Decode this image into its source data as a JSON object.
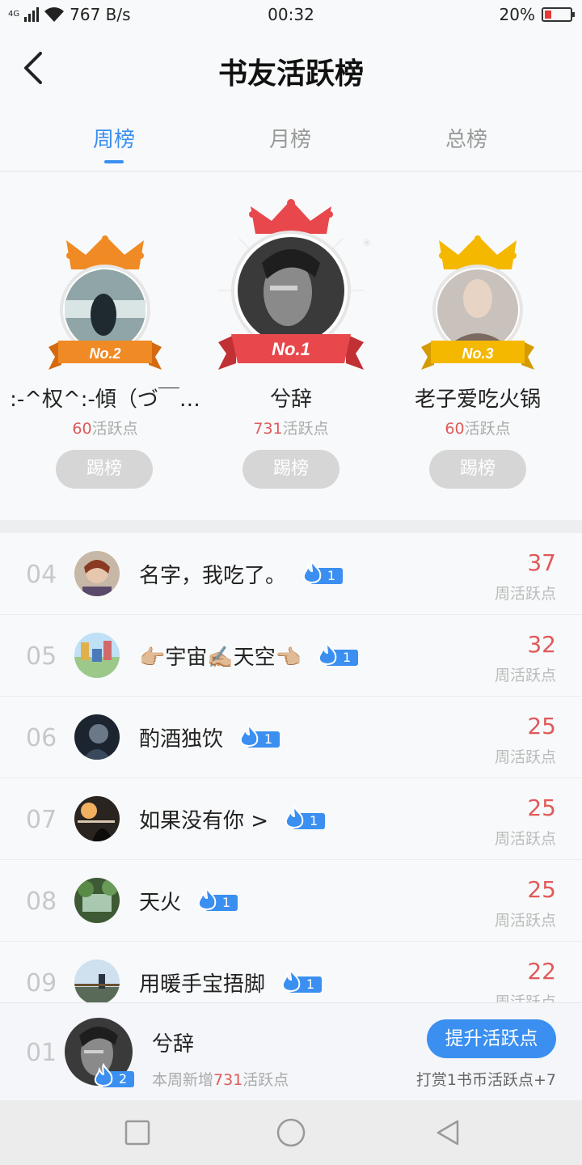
{
  "status_bar": {
    "network": "4G",
    "speed": "767 B/s",
    "time": "00:32",
    "battery": "20%"
  },
  "header": {
    "title": "书友活跃榜"
  },
  "tabs": [
    {
      "label": "周榜",
      "active": true
    },
    {
      "label": "月榜",
      "active": false
    },
    {
      "label": "总榜",
      "active": false
    }
  ],
  "podium": {
    "second": {
      "badge": "No.2",
      "name": ":-^权^:-傾（づ￣…",
      "points": "60",
      "points_suffix": "活跃点",
      "button": "踢榜"
    },
    "first": {
      "badge": "No.1",
      "name": "兮辞",
      "points": "731",
      "points_suffix": "活跃点",
      "button": "踢榜"
    },
    "third": {
      "badge": "No.3",
      "name": "老子爱吃火锅",
      "points": "60",
      "points_suffix": "活跃点",
      "button": "踢榜"
    }
  },
  "list": [
    {
      "rank": "04",
      "name": "名字，我吃了。",
      "level": "1",
      "score": "37",
      "score_label": "周活跃点"
    },
    {
      "rank": "05",
      "name": "👉🏼宇宙✍🏼天空👈🏼",
      "level": "1",
      "score": "32",
      "score_label": "周活跃点"
    },
    {
      "rank": "06",
      "name": "酌酒独饮",
      "level": "1",
      "score": "25",
      "score_label": "周活跃点"
    },
    {
      "rank": "07",
      "name": "如果没有你 >",
      "level": "1",
      "score": "25",
      "score_label": "周活跃点"
    },
    {
      "rank": "08",
      "name": "天火",
      "level": "1",
      "score": "25",
      "score_label": "周活跃点"
    },
    {
      "rank": "09",
      "name": "用暖手宝捂脚",
      "level": "1",
      "score": "22",
      "score_label": "周活跃点"
    }
  ],
  "my_rank": {
    "rank": "01",
    "name": "兮辞",
    "level": "2",
    "desc_prefix": "本周新增",
    "desc_value": "731",
    "desc_suffix": "活跃点",
    "button": "提升活跃点",
    "hint": "打赏1书币活跃点+7"
  },
  "colors": {
    "accent": "#3a8ff0",
    "score_red": "#e05a5a",
    "crown_orange": "#f08a24",
    "crown_red": "#e8484c",
    "crown_gold": "#f5b800"
  },
  "icons": {
    "back": "chevron-left-icon",
    "level": "flame-icon",
    "nav": [
      "square-icon",
      "circle-icon",
      "triangle-back-icon"
    ]
  }
}
